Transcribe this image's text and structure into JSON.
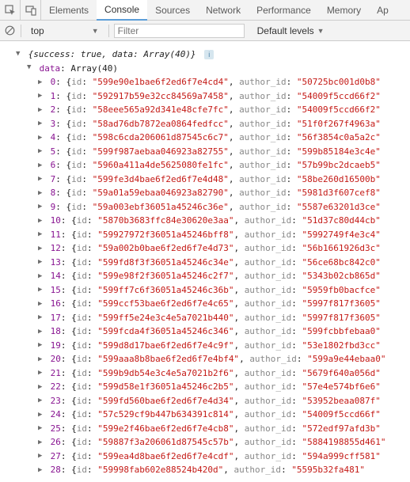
{
  "toolbar": {
    "tabs": [
      "Elements",
      "Console",
      "Sources",
      "Network",
      "Performance",
      "Memory",
      "Ap"
    ],
    "active": "Console"
  },
  "filterbar": {
    "context": "top",
    "filter_placeholder": "Filter",
    "levels_label": "Default levels"
  },
  "root": {
    "line": "{success: true, data: Array(40)}",
    "success_key": "success",
    "success_val": "true",
    "data_key": "data",
    "data_desc": "Array(40)"
  },
  "data_label": "data",
  "data_type": "Array(40)",
  "rows": [
    {
      "i": 0,
      "id": "599e90e1bae6f2ed6f7e4cd4",
      "aid": "50725bc001d0b8"
    },
    {
      "i": 1,
      "id": "592917b59e32cc84569a7458",
      "aid": "54009f5ccd66f2"
    },
    {
      "i": 2,
      "id": "58eee565a92d341e48cfe7fc",
      "aid": "54009f5ccd66f2"
    },
    {
      "i": 3,
      "id": "58ad76db7872ea0864fedfcc",
      "aid": "51f0f267f4963a"
    },
    {
      "i": 4,
      "id": "598c6cda206061d87545c6c7",
      "aid": "56f3854c0a5a2c"
    },
    {
      "i": 5,
      "id": "599f987aebaa046923a82755",
      "aid": "599b85184e3c4e"
    },
    {
      "i": 6,
      "id": "5960a411a4de5625080fe1fc",
      "aid": "57b99bc2dcaeb5"
    },
    {
      "i": 7,
      "id": "599fe3d4bae6f2ed6f7e4d48",
      "aid": "58be260d16500b"
    },
    {
      "i": 8,
      "id": "59a01a59ebaa046923a82790",
      "aid": "5981d3f607cef8"
    },
    {
      "i": 9,
      "id": "59a003ebf36051a45246c36e",
      "aid": "5587e63201d3ce"
    },
    {
      "i": 10,
      "id": "5870b3683ffc84e30620e3aa",
      "aid": "51d37c80d44cb"
    },
    {
      "i": 11,
      "id": "59927972f36051a45246bff8",
      "aid": "5992749f4e3c4"
    },
    {
      "i": 12,
      "id": "59a002b0bae6f2ed6f7e4d73",
      "aid": "56b1661926d3c"
    },
    {
      "i": 13,
      "id": "599fd8f3f36051a45246c34e",
      "aid": "56ce68bc842c0"
    },
    {
      "i": 14,
      "id": "599e98f2f36051a45246c2f7",
      "aid": "5343b02cb865d"
    },
    {
      "i": 15,
      "id": "599ff7c6f36051a45246c36b",
      "aid": "5959fb0bacfce"
    },
    {
      "i": 16,
      "id": "599ccf53bae6f2ed6f7e4c65",
      "aid": "5997f817f3605"
    },
    {
      "i": 17,
      "id": "599ff5e24e3c4e5a7021b440",
      "aid": "5997f817f3605"
    },
    {
      "i": 18,
      "id": "599fcda4f36051a45246c346",
      "aid": "599fcbbfebaa0"
    },
    {
      "i": 19,
      "id": "599d8d17bae6f2ed6f7e4c9f",
      "aid": "53e1802fbd3cc"
    },
    {
      "i": 20,
      "id": "599aaa8b8bae6f2ed6f7e4bf4",
      "aid": "599a9e44ebaa0"
    },
    {
      "i": 21,
      "id": "599b9db54e3c4e5a7021b2f6",
      "aid": "5679f640a056d"
    },
    {
      "i": 22,
      "id": "599d58e1f36051a45246c2b5",
      "aid": "57e4e574bf6e6"
    },
    {
      "i": 23,
      "id": "599fd560bae6f2ed6f7e4d34",
      "aid": "53952beaa087f"
    },
    {
      "i": 24,
      "id": "57c529cf9b447b634391c814",
      "aid": "54009f5ccd66f"
    },
    {
      "i": 25,
      "id": "599e2f46bae6f2ed6f7e4cb8",
      "aid": "572edf97afd3b"
    },
    {
      "i": 26,
      "id": "59887f3a206061d87545c57b",
      "aid": "5884198855d461"
    },
    {
      "i": 27,
      "id": "599ea4d8bae6f2ed6f7e4cdf",
      "aid": "594a999cff581"
    },
    {
      "i": 28,
      "id": "59998fab602e88524b420d",
      "aid": "5595b32fa481"
    }
  ]
}
